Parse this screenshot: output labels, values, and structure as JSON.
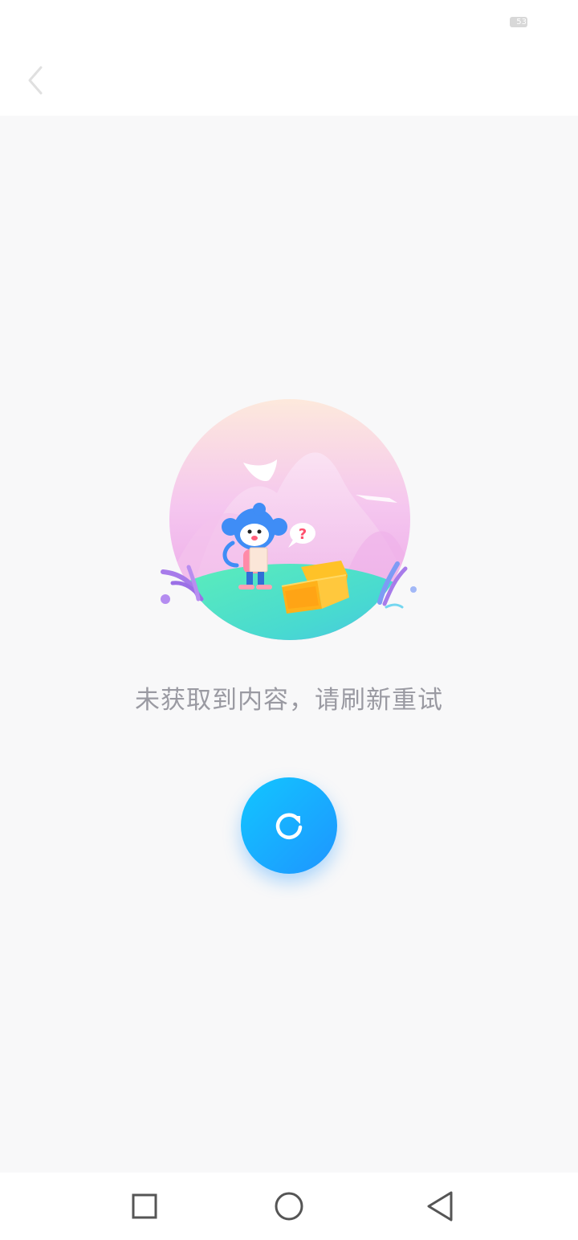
{
  "status_bar": {
    "battery_level": "53"
  },
  "top_bar": {
    "back_icon": "chevron-left-icon"
  },
  "empty_state": {
    "illustration": "monkey-treasure-chest-illustration",
    "message": "未获取到内容，请刷新重试",
    "refresh_icon": "refresh-icon"
  },
  "nav_bar": {
    "recents_icon": "square-icon",
    "home_icon": "circle-icon",
    "back_icon": "triangle-back-icon"
  },
  "colors": {
    "accent": "#1EA8FF",
    "message_text": "#9A9AA2",
    "background": "#F8F8F9"
  }
}
